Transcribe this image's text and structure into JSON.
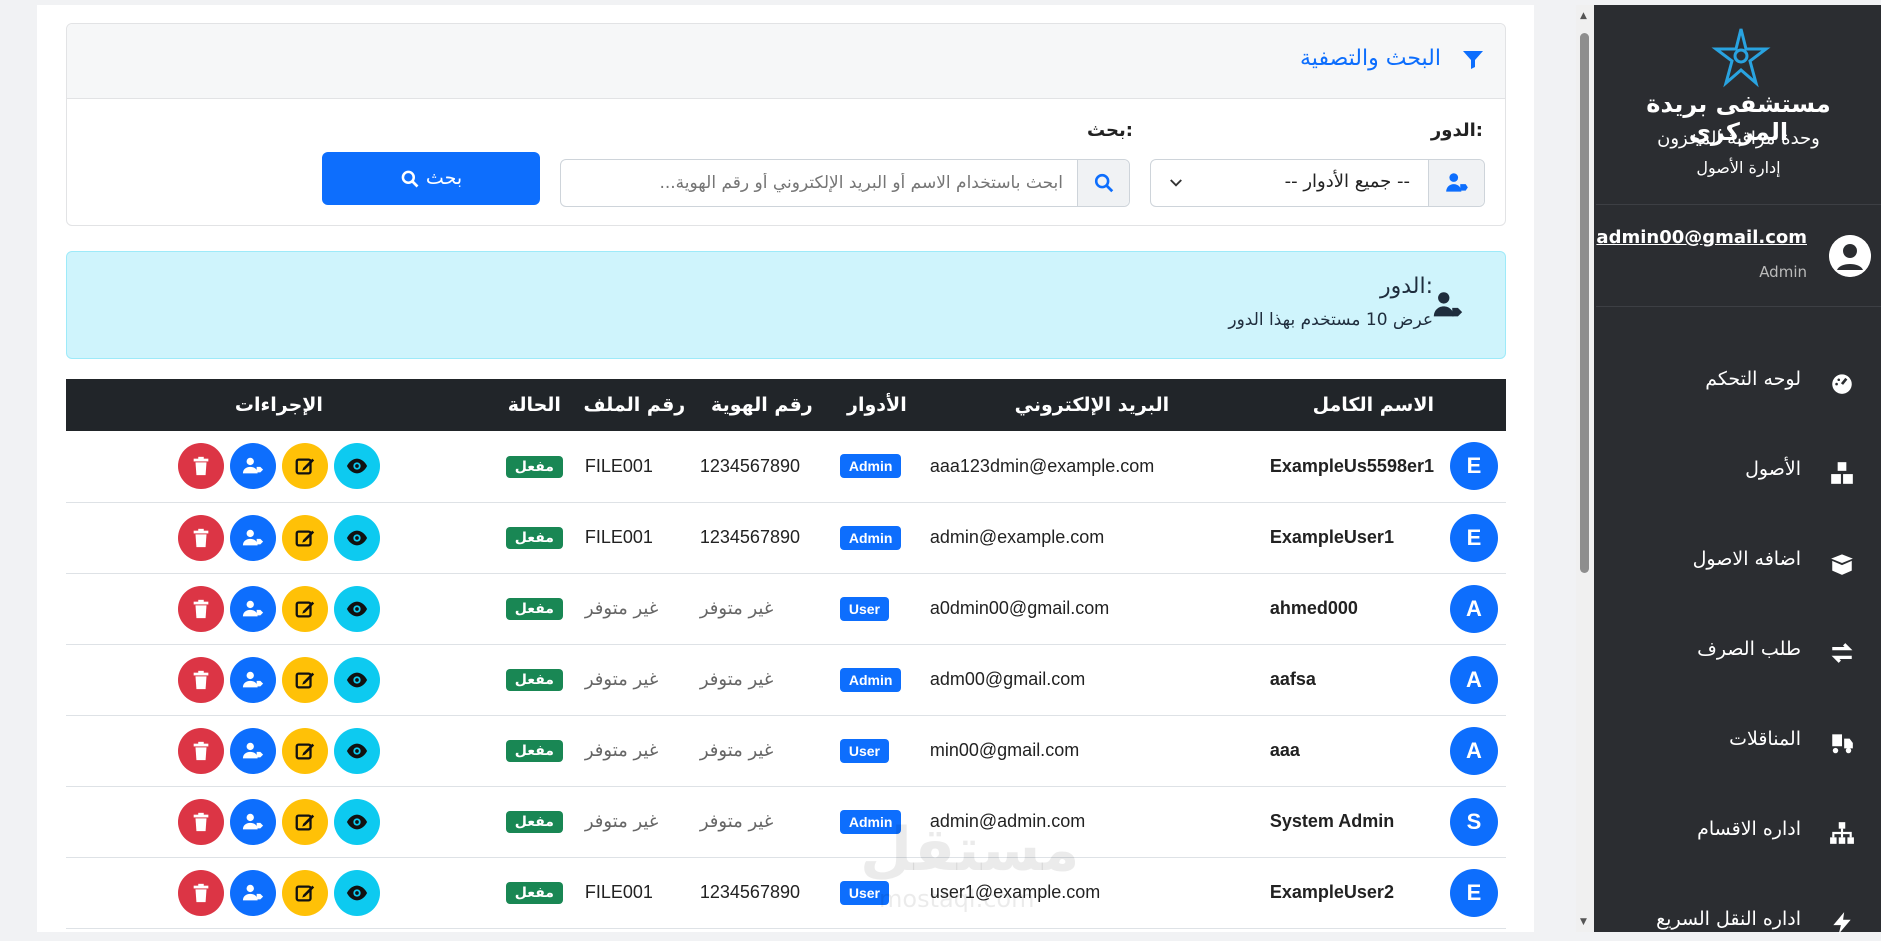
{
  "brand": {
    "hospital": "مستشفى بريدة المركزي",
    "unit": "وحدة مراقبة المخزون",
    "dept": "إدارة الأصول"
  },
  "user": {
    "email": "admin00@gmail.com",
    "role": "Admin"
  },
  "nav": [
    {
      "label": "لوحه التحكم",
      "icon": "dashboard-icon"
    },
    {
      "label": "الأصول",
      "icon": "boxes-icon"
    },
    {
      "label": "اضافه الاصول",
      "icon": "box-open-icon"
    },
    {
      "label": "طلب الصرف",
      "icon": "exchange-icon"
    },
    {
      "label": "المناقلات",
      "icon": "transfer-icon"
    },
    {
      "label": "اداره الاقسام",
      "icon": "sitemap-icon"
    },
    {
      "label": "اداره النقل السريع",
      "icon": "bolt-icon"
    }
  ],
  "filter": {
    "title": "البحث والتصفية",
    "role_label": "الدور:",
    "role_value": "-- جميع الأدوار --",
    "search_label": "بحث:",
    "search_placeholder": "ابحث باستخدام الاسم أو البريد الإلكتروني أو رقم الهوية...",
    "search_button": "بحث"
  },
  "alert": {
    "title": "الدور:",
    "subtitle": "عرض 10 مستخدم بهذا الدور"
  },
  "table": {
    "headers": [
      "الاسم الكامل",
      "البريد الإلكتروني",
      "الأدوار",
      "رقم الهوية",
      "رقم الملف",
      "الحالة",
      "الإجراءات"
    ],
    "rows": [
      {
        "initial": "E",
        "name": "ExampleUs5598er1",
        "email": "aaa123dmin@example.com",
        "role": "Admin",
        "id": "1234567890",
        "file": "FILE001",
        "status": "مفعل"
      },
      {
        "initial": "E",
        "name": "ExampleUser1",
        "email": "admin@example.com",
        "role": "Admin",
        "id": "1234567890",
        "file": "FILE001",
        "status": "مفعل"
      },
      {
        "initial": "A",
        "name": "ahmed000",
        "email": "a0dmin00@gmail.com",
        "role": "User",
        "id": "غير متوفر",
        "file": "غير متوفر",
        "status": "مفعل"
      },
      {
        "initial": "A",
        "name": "aafsa",
        "email": "adm00@gmail.com",
        "role": "Admin",
        "id": "غير متوفر",
        "file": "غير متوفر",
        "status": "مفعل"
      },
      {
        "initial": "A",
        "name": "aaa",
        "email": "min00@gmail.com",
        "role": "User",
        "id": "غير متوفر",
        "file": "غير متوفر",
        "status": "مفعل"
      },
      {
        "initial": "S",
        "name": "System Admin",
        "email": "admin@admin.com",
        "role": "Admin",
        "id": "غير متوفر",
        "file": "غير متوفر",
        "status": "مفعل"
      },
      {
        "initial": "E",
        "name": "ExampleUser2",
        "email": "user1@example.com",
        "role": "User",
        "id": "1234567890",
        "file": "FILE001",
        "status": "مفعل"
      }
    ]
  },
  "watermark": {
    "text": "مستقل",
    "sub": "mostaql.com"
  },
  "colors": {
    "primary": "#0d6efd",
    "sidebar": "#2b2d31",
    "success": "#198754",
    "info": "#0dcaf0",
    "warning": "#ffc107",
    "danger": "#dc3545"
  }
}
